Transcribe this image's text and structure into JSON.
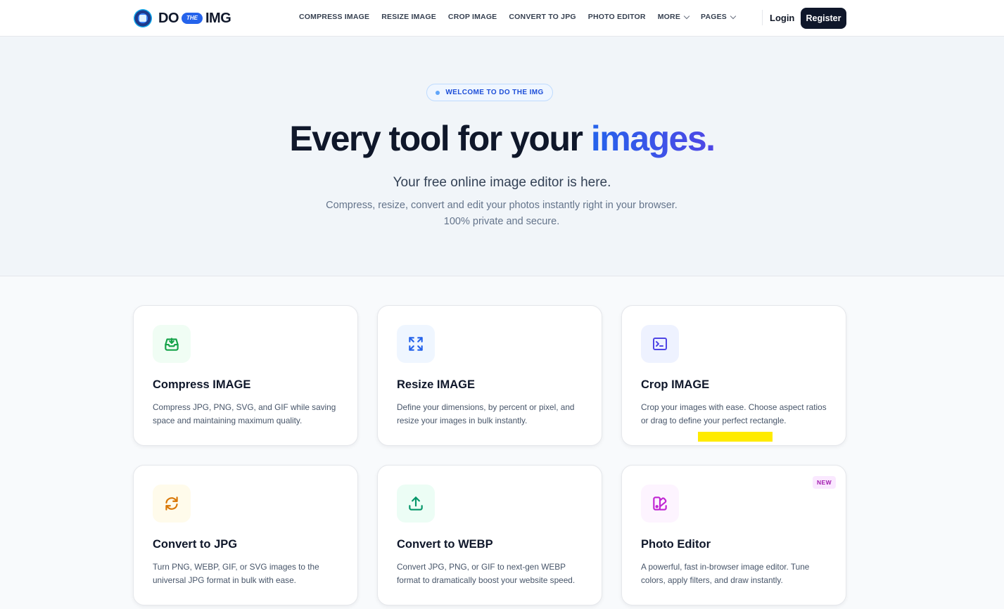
{
  "brand": {
    "do": "DO",
    "the": "THE",
    "img": "IMG"
  },
  "nav": {
    "items": [
      "COMPRESS IMAGE",
      "RESIZE IMAGE",
      "CROP IMAGE",
      "CONVERT TO JPG",
      "PHOTO EDITOR"
    ],
    "more": "MORE",
    "pages": "PAGES"
  },
  "auth": {
    "login": "Login",
    "register": "Register"
  },
  "hero": {
    "badge": "WELCOME TO DO THE IMG",
    "title_main": "Every tool for your ",
    "title_accent": "images.",
    "subtitle": "Your free online image editor is here.",
    "description": "Compress, resize, convert and edit your photos instantly right in your browser. 100% private and secure."
  },
  "tools": [
    {
      "title": "Compress IMAGE",
      "desc": "Compress JPG, PNG, SVG, and GIF while saving space and maintaining maximum quality.",
      "icon": "download-tray-icon",
      "color": "#16a34a",
      "bg": "#f0fdf4"
    },
    {
      "title": "Resize IMAGE",
      "desc": "Define your dimensions, by percent or pixel, and resize your images in bulk instantly.",
      "icon": "expand-arrows-icon",
      "color": "#2563eb",
      "bg": "#eff6ff"
    },
    {
      "title": "Crop IMAGE",
      "desc": "Crop your images with ease. Choose aspect ratios or drag to define your perfect rectangle.",
      "icon": "crop-frame-icon",
      "color": "#4f46e5",
      "bg": "#eef2ff"
    },
    {
      "title": "Convert to JPG",
      "desc": "Turn PNG, WEBP, GIF, or SVG images to the universal JPG format in bulk with ease.",
      "icon": "refresh-arrows-icon",
      "color": "#d97706",
      "bg": "#fffbeb"
    },
    {
      "title": "Convert to WEBP",
      "desc": "Convert JPG, PNG, or GIF to next-gen WEBP format to dramatically boost your website speed.",
      "icon": "upload-arrow-icon",
      "color": "#059669",
      "bg": "#ecfdf5"
    },
    {
      "title": "Photo Editor",
      "desc": "A powerful, fast in-browser image editor. Tune colors, apply filters, and draw instantly.",
      "icon": "palette-edit-icon",
      "color": "#c026d3",
      "bg": "#fdf4ff",
      "badge": "NEW"
    }
  ],
  "colors": {
    "accent": "#2563eb",
    "dark": "#0f172a",
    "highlight": "#ffeb00"
  }
}
